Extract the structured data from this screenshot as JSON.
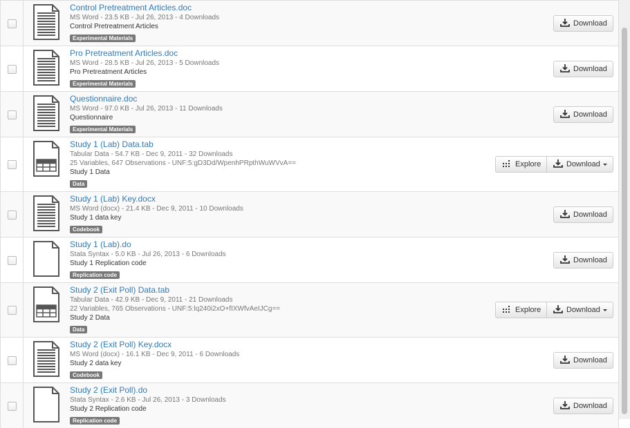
{
  "files": [
    {
      "name": "Control Pretreatment Articles.doc",
      "meta": "MS Word - 23.5 KB - Jul 26, 2013 - 4 Downloads",
      "desc": "Control Pretreatment Articles",
      "tag": "Experimental Materials",
      "icon": "document-icon",
      "explore": false
    },
    {
      "name": "Pro Pretreatment Articles.doc",
      "meta": "MS Word - 28.5 KB - Jul 26, 2013 - 5 Downloads",
      "desc": "Pro Pretreatment Articles",
      "tag": "Experimental Materials",
      "icon": "document-icon",
      "explore": false
    },
    {
      "name": "Questionnaire.doc",
      "meta": "MS Word - 97.0 KB - Jul 26, 2013 - 11 Downloads",
      "desc": "Questionnaire",
      "tag": "Experimental Materials",
      "icon": "document-icon",
      "explore": false
    },
    {
      "name": "Study 1 (Lab) Data.tab",
      "meta": "Tabular Data - 54.7 KB - Dec 9, 2011 - 32 Downloads",
      "extra": "25 Variables, 647 Observations - UNF:5:gD3Dd/WpenhPRpthWuWVvA==",
      "desc": "Study 1 Data",
      "tag": "Data",
      "icon": "table-file-icon",
      "explore": true
    },
    {
      "name": "Study 1 (Lab) Key.docx",
      "meta": "MS Word (docx) - 21.4 KB - Dec 9, 2011 - 10 Downloads",
      "desc": "Study 1 data key",
      "tag": "Codebook",
      "icon": "document-icon",
      "explore": false
    },
    {
      "name": "Study 1 (Lab).do",
      "meta": "Stata Syntax - 5.0 KB - Jul 26, 2013 - 6 Downloads",
      "desc": "Study 1 Replication code",
      "tag": "Replication code",
      "icon": "blank-file-icon",
      "explore": false
    },
    {
      "name": "Study 2 (Exit Poll) Data.tab",
      "meta": "Tabular Data - 42.9 KB - Dec 9, 2011 - 21 Downloads",
      "extra": "22 Variables, 765 Observations - UNF:5:lq240i2xO+fIXWfvAeIJCg==",
      "desc": "Study 2 Data",
      "tag": "Data",
      "icon": "table-file-icon",
      "explore": true
    },
    {
      "name": "Study 2 (Exit Poll) Key.docx",
      "meta": "MS Word (docx) - 16.1 KB - Dec 9, 2011 - 6 Downloads",
      "desc": "Study 2 data key",
      "tag": "Codebook",
      "icon": "document-icon",
      "explore": false
    },
    {
      "name": "Study 2 (Exit Poll).do",
      "meta": "Stata Syntax - 2.6 KB - Jul 26, 2013 - 3 Downloads",
      "desc": "Study 2 Replication code",
      "tag": "Replication code",
      "icon": "blank-file-icon",
      "explore": false
    }
  ],
  "labels": {
    "download": "Download",
    "explore": "Explore"
  },
  "colors": {
    "link": "#337ab7",
    "tag_bg": "#777777",
    "row_alt": "#f9f9f9"
  }
}
